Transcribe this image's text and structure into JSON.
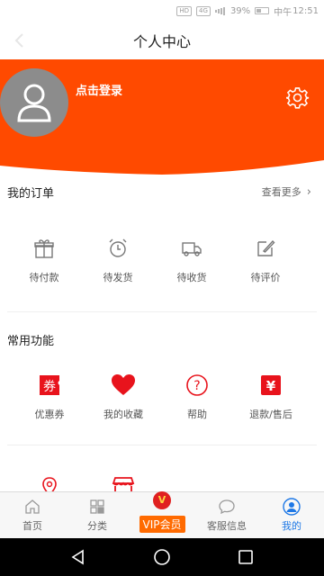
{
  "status_bar": {
    "hd_badge": "HD",
    "network": "4G",
    "battery_percent": "39%",
    "carrier": "中午",
    "time": "12:51"
  },
  "header": {
    "title": "个人中心"
  },
  "profile": {
    "login_label": "点击登录",
    "accent_color": "#ff4a00"
  },
  "orders": {
    "title": "我的订单",
    "see_more": "查看更多",
    "items": [
      {
        "label": "待付款",
        "icon": "gift-icon"
      },
      {
        "label": "待发货",
        "icon": "alarm-clock-icon"
      },
      {
        "label": "待收货",
        "icon": "truck-icon"
      },
      {
        "label": "待评价",
        "icon": "edit-icon"
      }
    ]
  },
  "functions": {
    "title": "常用功能",
    "items": [
      {
        "label": "优惠券",
        "icon": "coupon-icon",
        "glyph": "券"
      },
      {
        "label": "我的收藏",
        "icon": "heart-icon"
      },
      {
        "label": "帮助",
        "icon": "help-icon"
      },
      {
        "label": "退款/售后",
        "icon": "refund-icon",
        "glyph": "¥"
      }
    ]
  },
  "tabs": [
    {
      "label": "首页",
      "icon": "home-icon",
      "active": false
    },
    {
      "label": "分类",
      "icon": "category-icon",
      "active": false
    },
    {
      "label": "VIP会员",
      "icon": "vip-icon",
      "badge": "V",
      "active": false
    },
    {
      "label": "客服信息",
      "icon": "chat-icon",
      "active": false
    },
    {
      "label": "我的",
      "icon": "user-icon",
      "active": true
    }
  ],
  "colors": {
    "brand_orange": "#ff4a00",
    "icon_red": "#e8131c",
    "active_blue": "#1e78e6"
  }
}
